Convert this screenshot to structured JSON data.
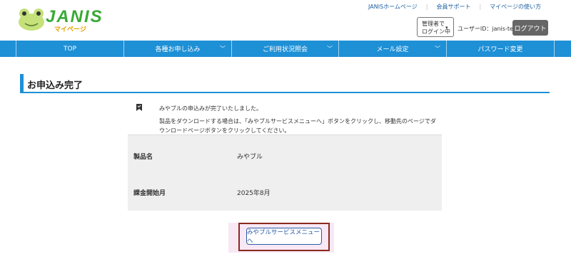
{
  "brand": {
    "name": "JANIS",
    "sub": "マイページ"
  },
  "top_links": [
    "JANISホームページ",
    "会員サポート",
    "マイページの使い方"
  ],
  "admin": {
    "line1": "管理者で",
    "line2": "ログイン中",
    "caret": "▾"
  },
  "user_id": "ユーザーID：janis-test",
  "logout_label": "ログアウト",
  "nav": [
    {
      "label": "TOP",
      "has_menu": false
    },
    {
      "label": "各種お申し込み",
      "has_menu": true
    },
    {
      "label": "ご利用状況照会",
      "has_menu": true
    },
    {
      "label": "メール設定",
      "has_menu": true
    },
    {
      "label": "パスワード変更",
      "has_menu": false
    }
  ],
  "page_title": "お申込み完了",
  "message": {
    "line1": "みやブルの申込みが完了いたしました。",
    "line2": "製品をダウンロードする場合は、「みやブルサービスメニューへ」ボタンをクリックし、移動先のページでダウンロードページボタンをクリックしてください。"
  },
  "details": [
    {
      "label": "製品名",
      "value": "みやブル"
    },
    {
      "label": "課金開始月",
      "value": "2025年8月"
    }
  ],
  "menu_button_label": "みやブルサービスメニューへ",
  "colors": {
    "nav": "#1e90d6",
    "logo": "#39a936",
    "highlight": "#8b2a1f"
  }
}
